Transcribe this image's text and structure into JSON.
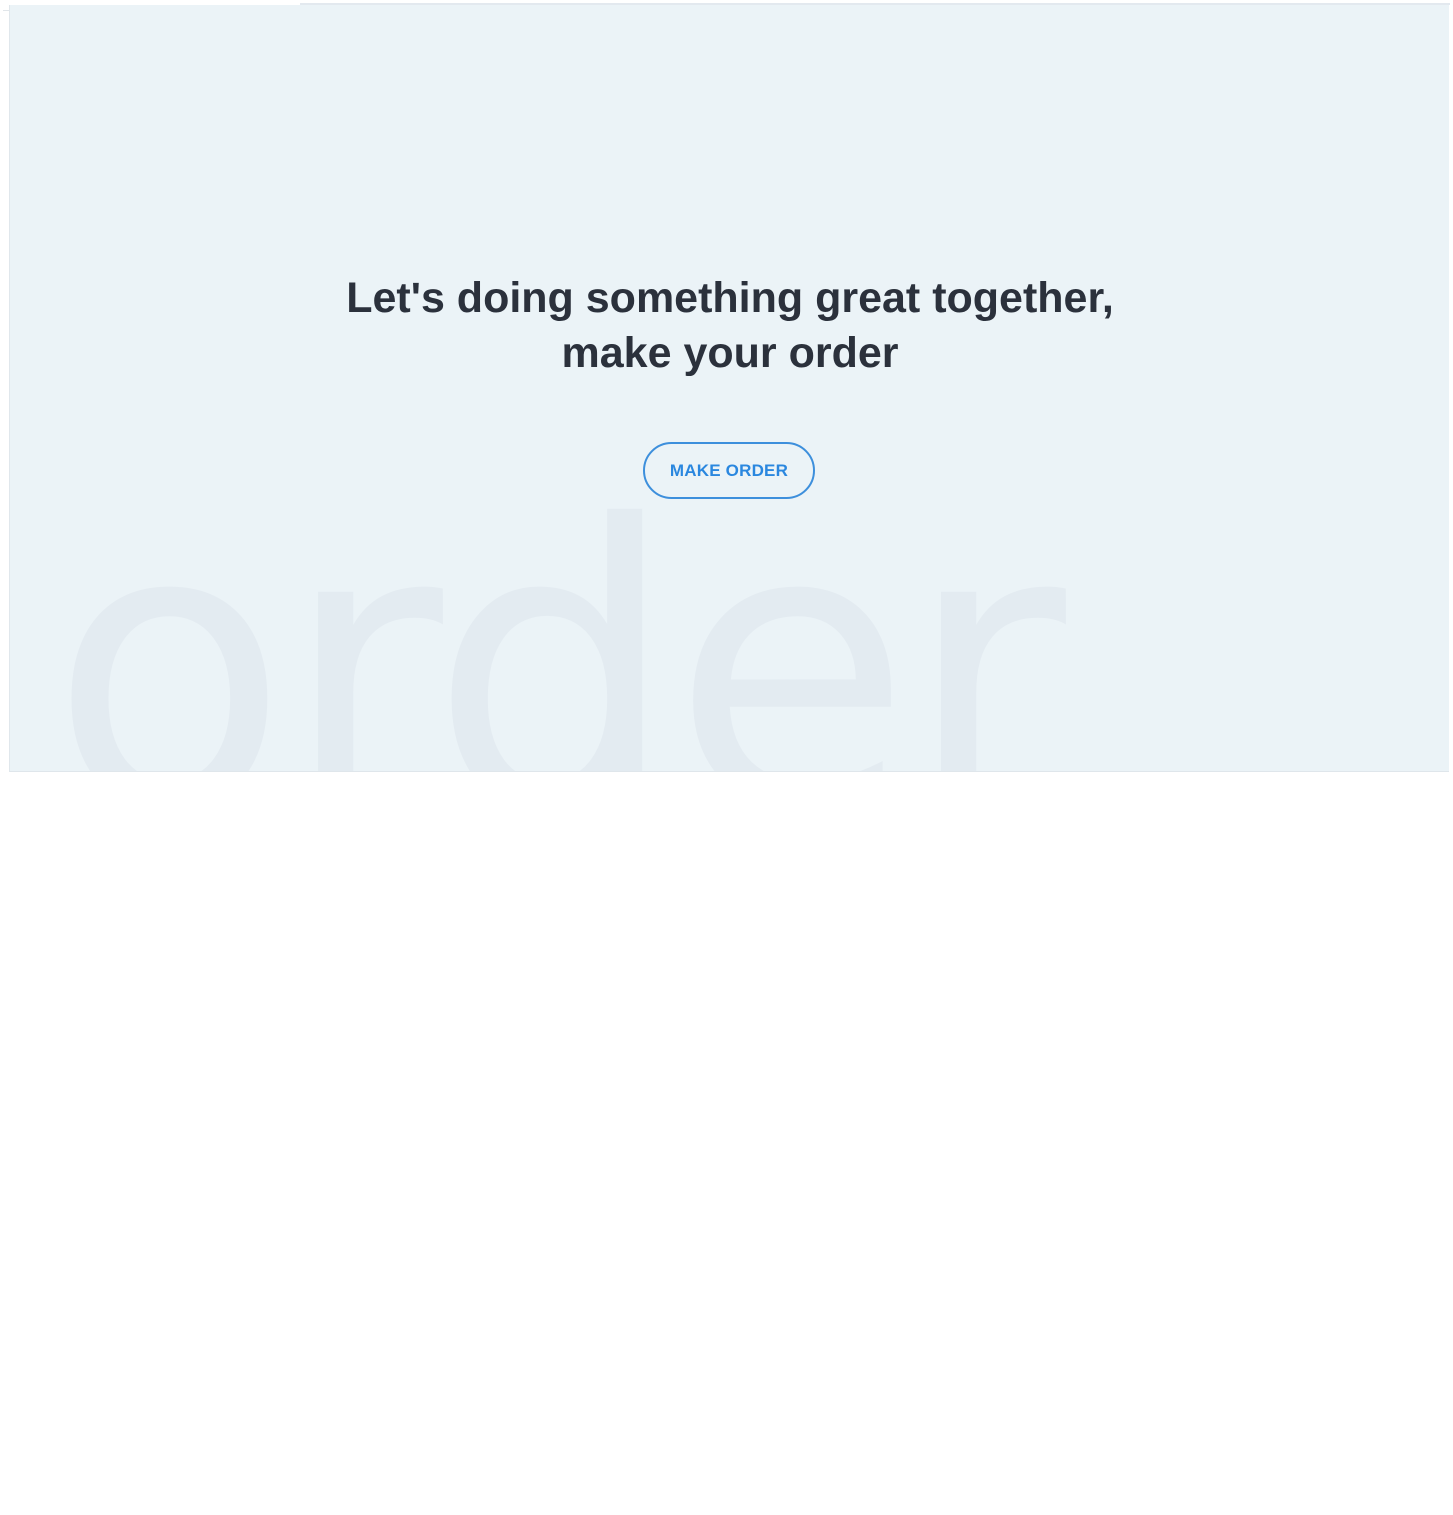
{
  "cta": {
    "headline_line1": "Let's doing something great together,",
    "headline_line2": "make your order",
    "button_label": "MAKE ORDER",
    "background_word": "order"
  },
  "colors": {
    "section_background": "#ebf3f7",
    "headline_text": "#2b313c",
    "button_accent": "#2a87df",
    "watermark_text": "#e3ebf1",
    "page_background": "#ffffff"
  }
}
